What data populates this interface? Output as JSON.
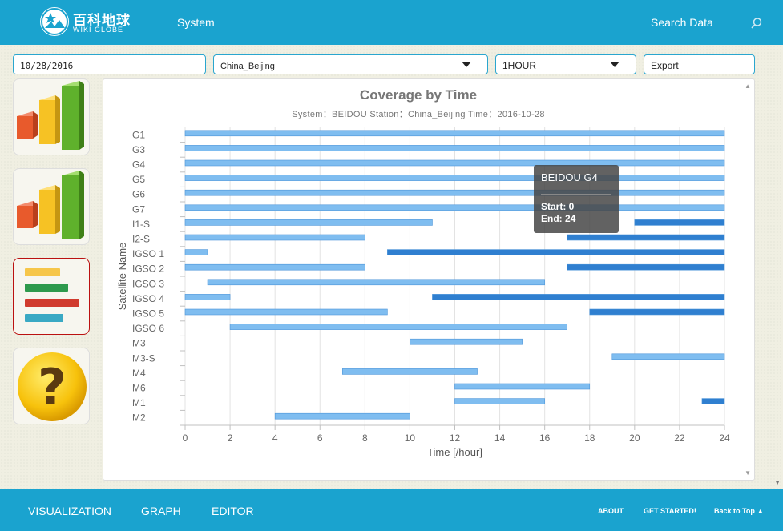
{
  "header": {
    "logo_cn": "百科地球",
    "logo_en": "WIKI GLOBE",
    "nav_system": "System",
    "search_label": "Search Data",
    "icons": [
      "globe-logo-icon",
      "search-icon"
    ]
  },
  "toolbar": {
    "date_value": "10/28/2016",
    "station_value": "China_Beijing",
    "interval_value": "1HOUR",
    "export_label": "Export"
  },
  "sidebar": {
    "items": [
      {
        "name": "bar-chart-icon"
      },
      {
        "name": "bar-chart-icon"
      },
      {
        "name": "gantt-chart-icon",
        "active": true
      },
      {
        "name": "help-question-icon"
      }
    ]
  },
  "chart_data": {
    "type": "bar",
    "title": "Coverage by Time",
    "subtitle": "System：BEIDOU    Station：China_Beijing    Time：2016-10-28",
    "xlabel": "Time [/hour]",
    "ylabel": "Satellite Name",
    "xlim": [
      0,
      24
    ],
    "xticks": [
      0,
      2,
      4,
      6,
      8,
      10,
      12,
      14,
      16,
      18,
      20,
      22,
      24
    ],
    "grid": true,
    "categories": [
      "G1",
      "G3",
      "G4",
      "G5",
      "G6",
      "G7",
      "I1-S",
      "I2-S",
      "IGSO 1",
      "IGSO 2",
      "IGSO 3",
      "IGSO 4",
      "IGSO 5",
      "IGSO 6",
      "M3",
      "M3-S",
      "M4",
      "M6",
      "M1",
      "M2"
    ],
    "series": [
      {
        "color": "#7fbdf0",
        "intervals": [
          {
            "cat": "G1",
            "start": 0,
            "end": 24
          },
          {
            "cat": "G3",
            "start": 0,
            "end": 24
          },
          {
            "cat": "G4",
            "start": 0,
            "end": 24
          },
          {
            "cat": "G5",
            "start": 0,
            "end": 24
          },
          {
            "cat": "G6",
            "start": 0,
            "end": 24
          },
          {
            "cat": "G7",
            "start": 0,
            "end": 24
          },
          {
            "cat": "I1-S",
            "start": 0,
            "end": 11
          },
          {
            "cat": "I2-S",
            "start": 0,
            "end": 8
          },
          {
            "cat": "IGSO 1",
            "start": 0,
            "end": 1
          },
          {
            "cat": "IGSO 2",
            "start": 0,
            "end": 8
          },
          {
            "cat": "IGSO 3",
            "start": 1,
            "end": 16
          },
          {
            "cat": "IGSO 4",
            "start": 0,
            "end": 2
          },
          {
            "cat": "IGSO 5",
            "start": 0,
            "end": 9
          },
          {
            "cat": "IGSO 6",
            "start": 2,
            "end": 17
          },
          {
            "cat": "M3",
            "start": 10,
            "end": 15
          },
          {
            "cat": "M3-S",
            "start": 19,
            "end": 24
          },
          {
            "cat": "M4",
            "start": 7,
            "end": 13
          },
          {
            "cat": "M6",
            "start": 12,
            "end": 18
          },
          {
            "cat": "M1",
            "start": 12,
            "end": 16
          },
          {
            "cat": "M2",
            "start": 4,
            "end": 10
          }
        ]
      },
      {
        "color": "#2f7fd0",
        "intervals": [
          {
            "cat": "I1-S",
            "start": 20,
            "end": 24
          },
          {
            "cat": "I2-S",
            "start": 17,
            "end": 24
          },
          {
            "cat": "IGSO 1",
            "start": 9,
            "end": 24
          },
          {
            "cat": "IGSO 2",
            "start": 17,
            "end": 24
          },
          {
            "cat": "IGSO 4",
            "start": 11,
            "end": 24
          },
          {
            "cat": "IGSO 5",
            "start": 18,
            "end": 24
          },
          {
            "cat": "M1",
            "start": 23,
            "end": 24
          }
        ]
      }
    ],
    "tooltip": {
      "title": "BEIDOU G4",
      "start_line": "Start: 0",
      "end_line": "End: 24"
    }
  },
  "footer": {
    "nav": [
      "VISUALIZATION",
      "GRAPH",
      "EDITOR"
    ],
    "links": [
      "ABOUT",
      "GET STARTED!",
      "Back to Top ▲"
    ]
  }
}
